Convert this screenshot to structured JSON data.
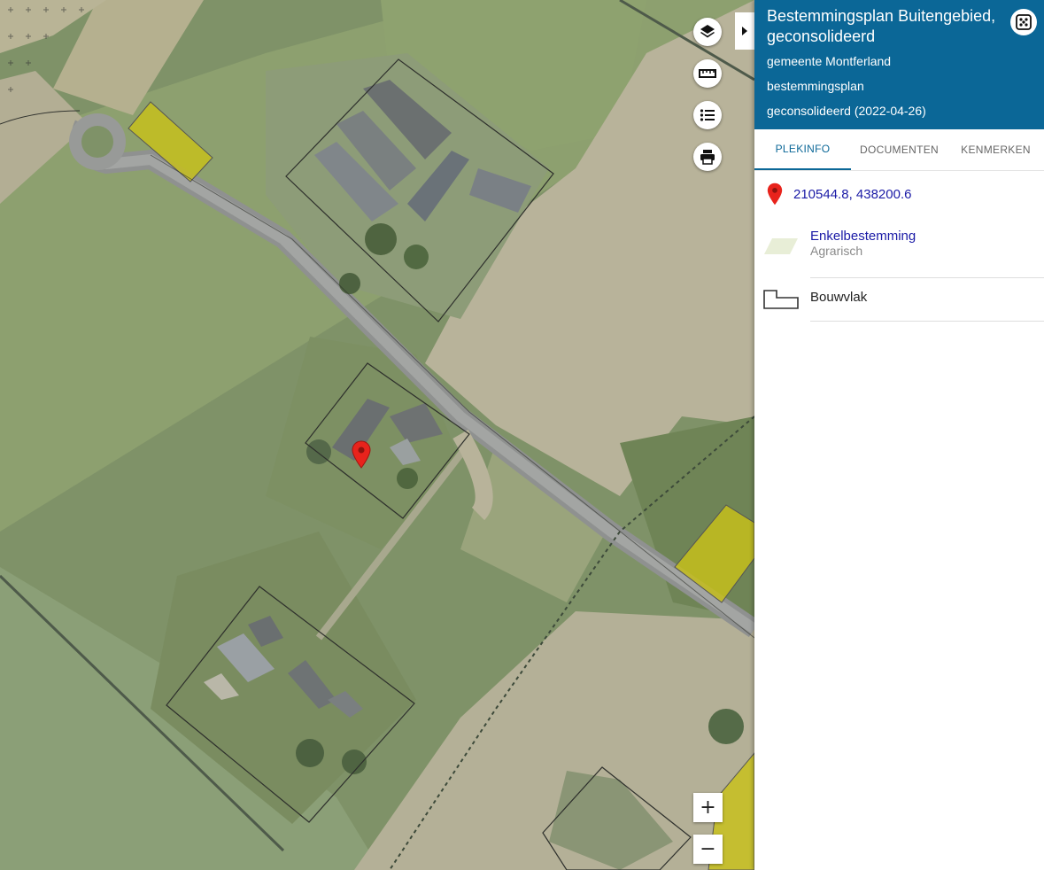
{
  "map": {
    "marker_name": "location-pin",
    "zone_color": "#c8c11a"
  },
  "controls": {
    "layers_icon": "layers-icon",
    "measure_icon": "ruler-icon",
    "legend_icon": "list-icon",
    "print_icon": "printer-icon",
    "toggle_icon": "chevron-right-icon",
    "zoom_in": "+",
    "zoom_out": "−"
  },
  "panel": {
    "title": "Bestemmingsplan Buitengebied, geconsolideerd",
    "municipality": "gemeente Montferland",
    "plan_type": "bestemmingsplan",
    "plan_status": "geconsolideerd (2022-04-26)",
    "header_color": "#0b6797",
    "detach_icon": "expand-dots-icon",
    "tabs": [
      {
        "label": "PLEKINFO",
        "active": true
      },
      {
        "label": "DOCUMENTEN",
        "active": false
      },
      {
        "label": "KENMERKEN",
        "active": false
      }
    ],
    "coordinates": "210544.8, 438200.6",
    "items": [
      {
        "title": "Enkelbestemming",
        "subtitle": "Agrarisch",
        "symbol": "parallelogram-green"
      },
      {
        "title": "Bouwvlak",
        "subtitle": "",
        "symbol": "building-outline"
      }
    ]
  }
}
